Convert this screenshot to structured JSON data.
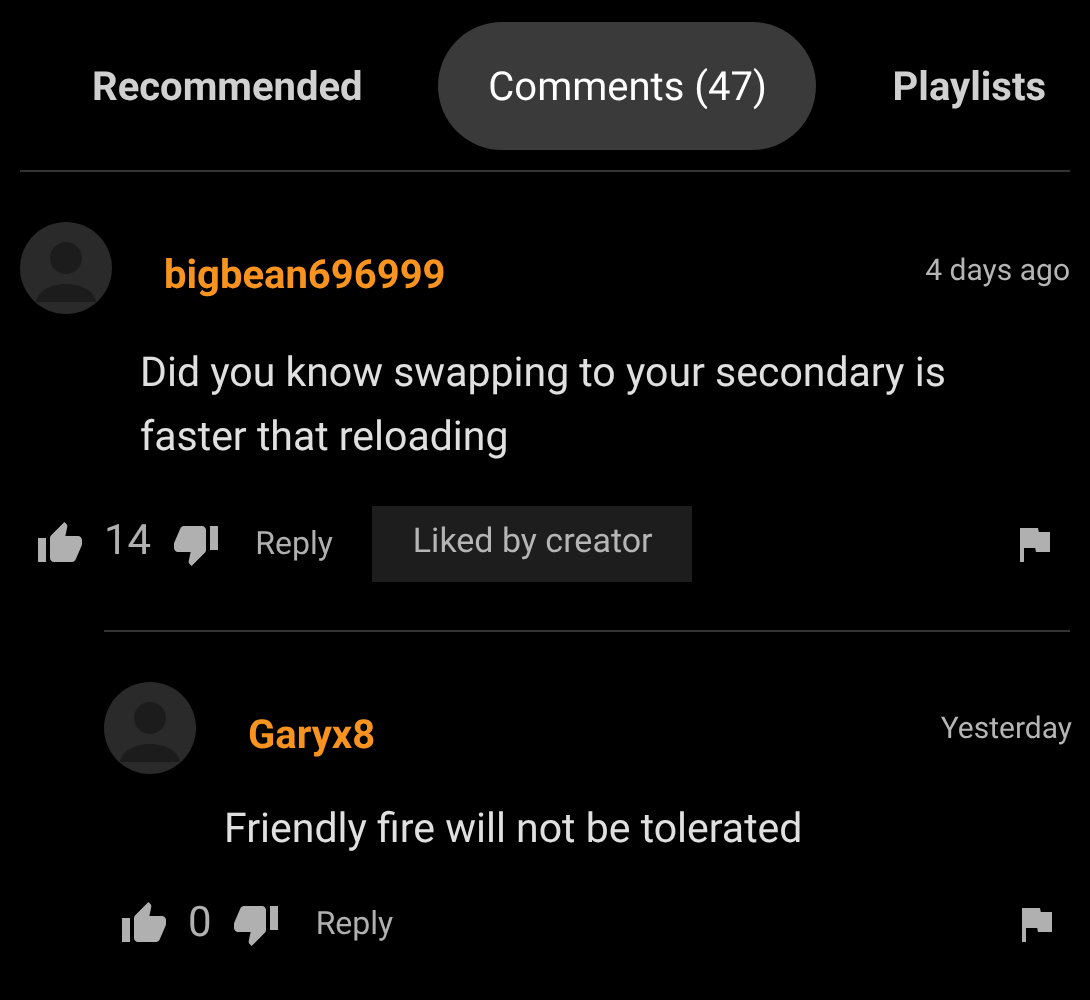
{
  "tabs": [
    {
      "label": "Recommended",
      "selected": false
    },
    {
      "label": "Comments (47)",
      "selected": true
    },
    {
      "label": "Playlists",
      "selected": false
    }
  ],
  "comments": [
    {
      "author": "bigbean696999",
      "time": "4 days ago",
      "text": "Did you know swapping to your secondary is faster that reloading",
      "likes": "14",
      "reply": "Reply",
      "badge": "Liked by creator",
      "replies": [
        {
          "author": "Garyx8",
          "time": "Yesterday",
          "text": "Friendly fire will not be tolerated",
          "likes": "0",
          "reply": "Reply"
        }
      ]
    }
  ]
}
